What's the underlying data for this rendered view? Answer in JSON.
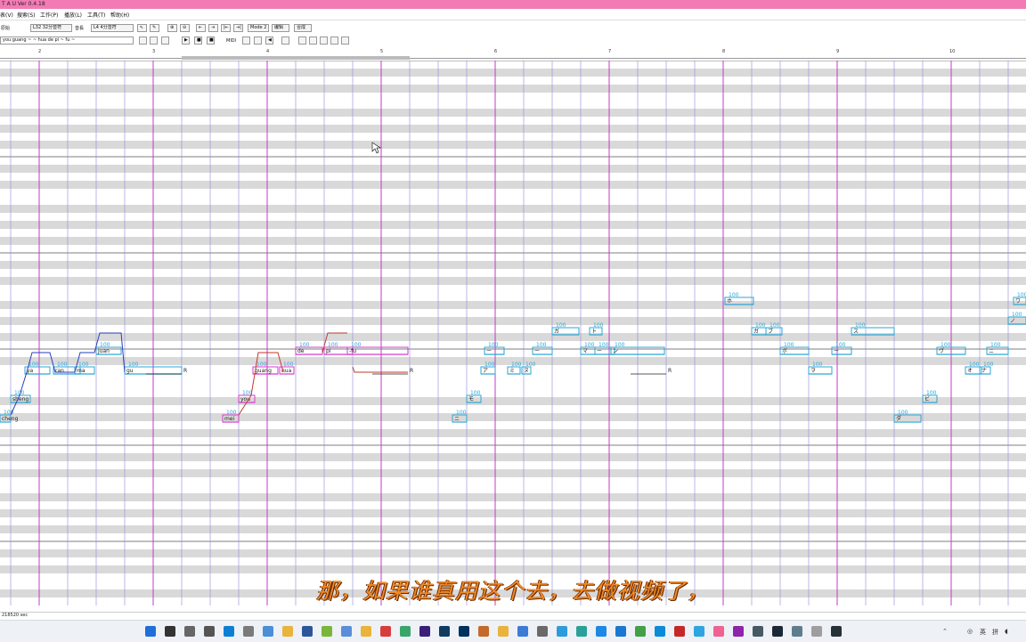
{
  "window": {
    "title": "T A U  Ver 0.4.18"
  },
  "menu": [
    "表(V)",
    "搜索(S)",
    "工作(P)",
    "播放(L)",
    "工具(T)",
    "帮助(H)"
  ],
  "toolbar": {
    "row1": {
      "mode_label": "原始",
      "note_select": "L32 32分音符",
      "sound_label": "音長",
      "length_select": "L4 4分音符",
      "mode_button": "Mode 2",
      "edit_button": "编辑",
      "synth_button": "合成",
      "btn_flags": [
        "⇖",
        "✎",
        "⊕",
        "⊖",
        "⇤",
        "⇥",
        "|⇤",
        "⇥|"
      ]
    },
    "row2": {
      "lyric_field": "you guang ~ ~ hua de pi ~ fu ~",
      "midi_label": "MIDI"
    }
  },
  "ruler": {
    "bars": [
      "2",
      "3",
      "4",
      "5",
      "6",
      "7",
      "8",
      "9",
      "10"
    ]
  },
  "roll": {
    "notes": [
      {
        "lyric": "cheng",
        "color": "#2aa7d8",
        "vel": "100"
      },
      {
        "lyric": "sheng",
        "color": "#2aa7d8",
        "vel": "100"
      },
      {
        "lyric": "ya",
        "color": "#2aa7d8",
        "vel": "100"
      },
      {
        "lyric": "ran",
        "color": "#2aa7d8",
        "vel": "100"
      },
      {
        "lyric": "ma",
        "color": "#2aa7d8",
        "vel": "100"
      },
      {
        "lyric": "juan",
        "color": "#2aa7d8",
        "vel": "100"
      },
      {
        "lyric": "gu",
        "color": "#2aa7d8",
        "vel": "100"
      },
      {
        "lyric": "R",
        "color": "#2aa7d8",
        "vel": ""
      },
      {
        "lyric": "mei",
        "color": "#d63ad0",
        "vel": "100"
      },
      {
        "lyric": "you",
        "color": "#d63ad0",
        "vel": "100"
      },
      {
        "lyric": "guang",
        "color": "#d63ad0",
        "vel": "100"
      },
      {
        "lyric": "hua",
        "color": "#d63ad0",
        "vel": "100"
      },
      {
        "lyric": "de",
        "color": "#d63ad0",
        "vel": "100"
      },
      {
        "lyric": "pi",
        "color": "#d63ad0",
        "vel": "100"
      },
      {
        "lyric": "-fu",
        "color": "#d63ad0",
        "vel": "100"
      },
      {
        "lyric": "R",
        "color": "#d63ad0",
        "vel": ""
      },
      {
        "lyric": "ニ",
        "color": "#2aa7d8",
        "vel": "100"
      },
      {
        "lyric": "モ",
        "color": "#2aa7d8",
        "vel": "100"
      },
      {
        "lyric": "ア",
        "color": "#2aa7d8",
        "vel": "100"
      },
      {
        "lyric": "ー",
        "color": "#2aa7d8",
        "vel": "100"
      },
      {
        "lyric": "ミ",
        "color": "#2aa7d8",
        "vel": "100"
      },
      {
        "lyric": "ヌ",
        "color": "#2aa7d8",
        "vel": "100"
      },
      {
        "lyric": "ー",
        "color": "#2aa7d8",
        "vel": "100"
      },
      {
        "lyric": "ガ",
        "color": "#2aa7d8",
        "vel": "100"
      },
      {
        "lyric": "ト",
        "color": "#2aa7d8",
        "vel": "100"
      },
      {
        "lyric": "マ",
        "color": "#2aa7d8",
        "vel": "100"
      },
      {
        "lyric": "ー",
        "color": "#2aa7d8",
        "vel": "100"
      },
      {
        "lyric": "ン",
        "color": "#2aa7d8",
        "vel": "100"
      },
      {
        "lyric": "R",
        "color": "#2aa7d8",
        "vel": ""
      },
      {
        "lyric": "ホ",
        "color": "#2aa7d8",
        "vel": "100"
      },
      {
        "lyric": "ガ",
        "color": "#2aa7d8",
        "vel": "100"
      },
      {
        "lyric": "ブ",
        "color": "#2aa7d8",
        "vel": "100"
      },
      {
        "lyric": "ボ",
        "color": "#2aa7d8",
        "vel": "100"
      },
      {
        "lyric": "ヲ",
        "color": "#2aa7d8",
        "vel": "100"
      },
      {
        "lyric": "ー",
        "color": "#2aa7d8",
        "vel": "100"
      },
      {
        "lyric": "ス",
        "color": "#2aa7d8",
        "vel": "100"
      },
      {
        "lyric": "ダ",
        "color": "#2aa7d8",
        "vel": "100"
      },
      {
        "lyric": "ビ",
        "color": "#2aa7d8",
        "vel": "100"
      },
      {
        "lyric": "ヴ",
        "color": "#2aa7d8",
        "vel": "100"
      },
      {
        "lyric": "オ",
        "color": "#2aa7d8",
        "vel": "100"
      },
      {
        "lyric": "ナ",
        "color": "#2aa7d8",
        "vel": "100"
      },
      {
        "lyric": "ニ",
        "color": "#2aa7d8",
        "vel": "100"
      },
      {
        "lyric": "ノ",
        "color": "#2aa7d8",
        "vel": "100"
      },
      {
        "lyric": "ワ",
        "color": "#2aa7d8",
        "vel": "100"
      },
      {
        "lyric": "ー",
        "color": "#2aa7d8",
        "vel": "100"
      },
      {
        "lyric": "ハ",
        "color": "#2aa7d8",
        "vel": "100"
      },
      {
        "lyric": "ア",
        "color": "#2aa7d8",
        "vel": "100"
      }
    ]
  },
  "status": {
    "text": "218520 sec"
  },
  "subtitle": {
    "text": "那，如果谁真用这个去，去做视频了，"
  },
  "taskbar": {
    "icons": [
      "windows-start-icon",
      "search-icon",
      "task-view-icon",
      "settings-icon",
      "edge-icon",
      "store-icon",
      "onedrive-icon",
      "files-icon",
      "word-icon",
      "note-icon",
      "app-icon",
      "folder-icon",
      "app2-icon",
      "app3-icon",
      "premiere-icon",
      "photoshop-icon",
      "audition-icon",
      "app4-icon",
      "folder2-icon",
      "app5-icon",
      "app6-icon",
      "browser1-icon",
      "browser2-icon",
      "browser3-icon",
      "browser4-icon",
      "browser5-icon",
      "browser6-icon",
      "app7-icon",
      "telegram-icon",
      "app8-icon",
      "app9-icon",
      "app10-icon",
      "steam-icon",
      "app11-icon",
      "app12-icon",
      "utau-icon"
    ],
    "tray": {
      "ime": "英",
      "lang": "拼"
    }
  }
}
